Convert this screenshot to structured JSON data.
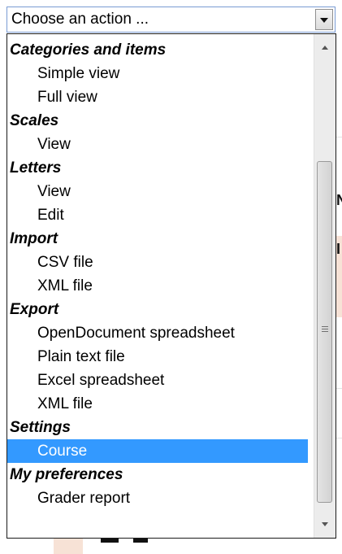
{
  "action_select": {
    "value": "Choose an action ...",
    "arrow_icon": "chevron-down-icon"
  },
  "background_fragments": {
    "char_1": "N",
    "char_2": "I"
  },
  "dropdown": {
    "groups": [
      {
        "label": "Categories and items",
        "items": [
          "Simple view",
          "Full view"
        ]
      },
      {
        "label": "Scales",
        "items": [
          "View"
        ]
      },
      {
        "label": "Letters",
        "items": [
          "View",
          "Edit"
        ]
      },
      {
        "label": "Import",
        "items": [
          "CSV file",
          "XML file"
        ]
      },
      {
        "label": "Export",
        "items": [
          "OpenDocument spreadsheet",
          "Plain text file",
          "Excel spreadsheet",
          "XML file"
        ]
      },
      {
        "label": "Settings",
        "items": [
          "Course"
        ]
      },
      {
        "label": "My preferences",
        "items": [
          "Grader report"
        ]
      }
    ],
    "selected_item": "Course",
    "colors": {
      "selected_bg": "#3399ff",
      "selected_text": "#ffffff",
      "background_tint": "#f7e2d6"
    }
  },
  "scrollbar": {
    "up_icon": "scroll-up-arrow-icon",
    "down_icon": "scroll-down-arrow-icon",
    "thumb_icon": "scroll-thumb-grip-icon"
  }
}
